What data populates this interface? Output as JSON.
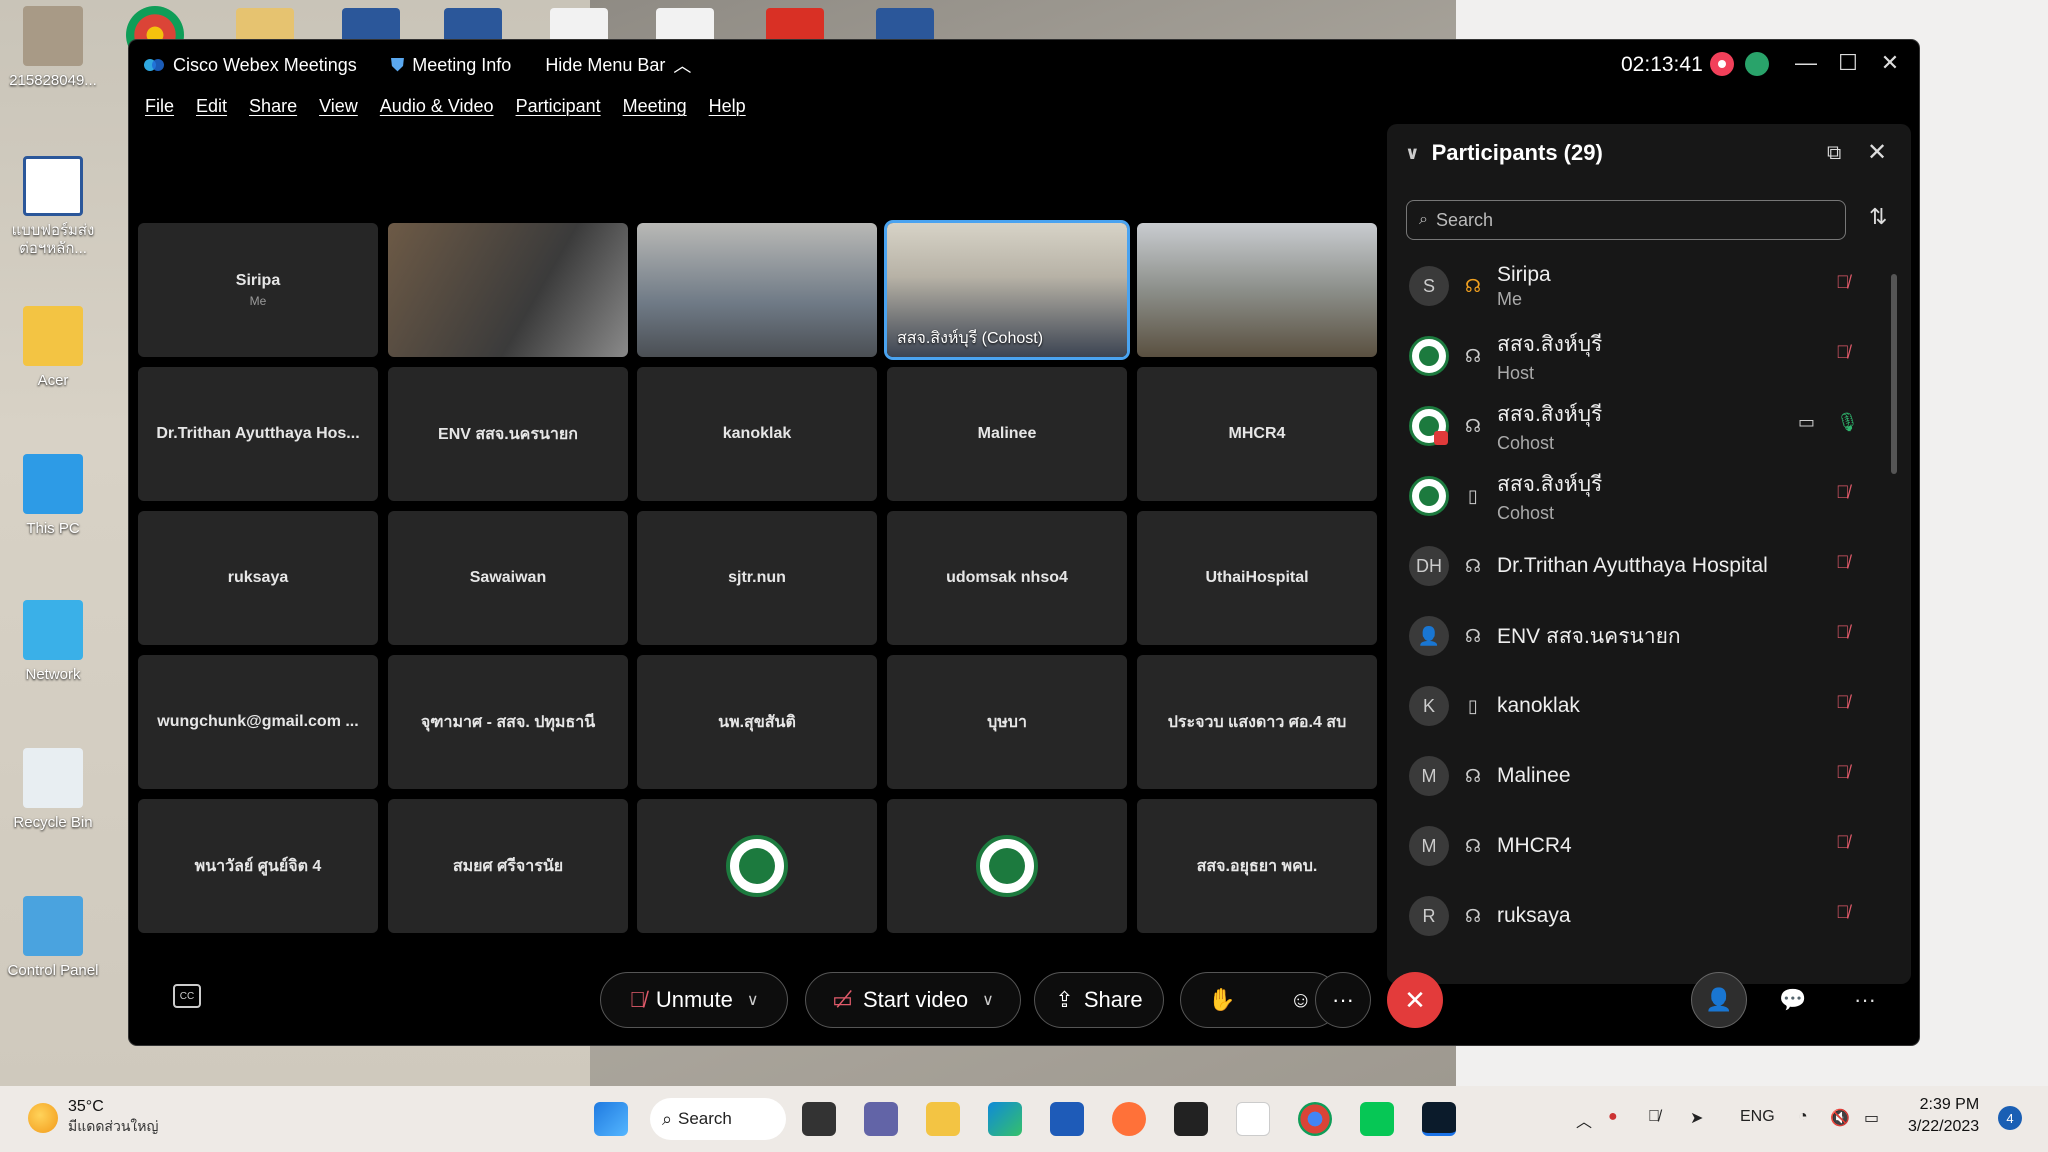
{
  "desktop": {
    "icons": [
      {
        "label": "215828049..."
      },
      {
        "label": "แบบฟอร์มส่ง ต่อฯหลัก..."
      },
      {
        "label": "Acer"
      },
      {
        "label": "This PC"
      },
      {
        "label": "Network"
      },
      {
        "label": "Recycle Bin"
      },
      {
        "label": "Control Panel"
      }
    ]
  },
  "window": {
    "app_title": "Cisco Webex Meetings",
    "meeting_info": "Meeting Info",
    "hide_menu": "Hide Menu Bar",
    "timer": "02:13:41",
    "menu": [
      "File",
      "Edit",
      "Share",
      "View",
      "Audio & Video",
      "Participant",
      "Meeting",
      "Help"
    ]
  },
  "grid": {
    "row1": [
      {
        "name": "Siripa",
        "sub": "Me"
      },
      {
        "name": ""
      },
      {
        "name": ""
      },
      {
        "name": "สสจ.สิงห์บุรี (Cohost)"
      },
      {
        "name": ""
      }
    ],
    "row2": [
      "Dr.Trithan Ayutthaya Hos...",
      "ENV สสจ.นครนายก",
      "kanoklak",
      "Malinee",
      "MHCR4"
    ],
    "row3": [
      "ruksaya",
      "Sawaiwan",
      "sjtr.nun",
      "udomsak nhso4",
      "UthaiHospital"
    ],
    "row4": [
      "wungchunk@gmail.com ...",
      "จุฑามาศ - สสจ. ปทุมธานี",
      "นพ.สุขสันติ",
      "บุษบา",
      "ประจวบ แสงดาว ศอ.4 สบ"
    ],
    "row5": [
      "พนาวัลย์ ศูนย์จิต 4",
      "สมยศ ศรีจารนัย",
      "",
      "",
      "สสจ.อยุธยา พคบ."
    ]
  },
  "participants": {
    "title": "Participants (29)",
    "search_placeholder": "Search",
    "list": [
      {
        "initials": "S",
        "name": "Siripa",
        "role": "Me"
      },
      {
        "initials": "",
        "name": "สสจ.สิงห์บุรี",
        "role": "Host"
      },
      {
        "initials": "",
        "name": "สสจ.สิงห์บุรี",
        "role": "Cohost"
      },
      {
        "initials": "",
        "name": "สสจ.สิงห์บุรี",
        "role": "Cohost"
      },
      {
        "initials": "DH",
        "name": "Dr.Trithan Ayutthaya Hospital",
        "role": ""
      },
      {
        "initials": "",
        "name": "ENV สสจ.นครนายก",
        "role": ""
      },
      {
        "initials": "K",
        "name": "kanoklak",
        "role": ""
      },
      {
        "initials": "M",
        "name": "Malinee",
        "role": ""
      },
      {
        "initials": "M",
        "name": "MHCR4",
        "role": ""
      },
      {
        "initials": "R",
        "name": "ruksaya",
        "role": ""
      }
    ]
  },
  "controls": {
    "unmute": "Unmute",
    "start_video": "Start video",
    "share": "Share"
  },
  "taskbar": {
    "temp": "35°C",
    "weather_desc": "มีแดดส่วนใหญ่",
    "search": "Search",
    "lang": "ENG",
    "time": "2:39 PM",
    "date": "3/22/2023",
    "notifications": "4"
  },
  "colors": {
    "accent_blue": "#4aa3f0",
    "end_red": "#e33b3b",
    "mute_red": "#e05a6a",
    "host_logo_green": "#1c7a3e"
  }
}
